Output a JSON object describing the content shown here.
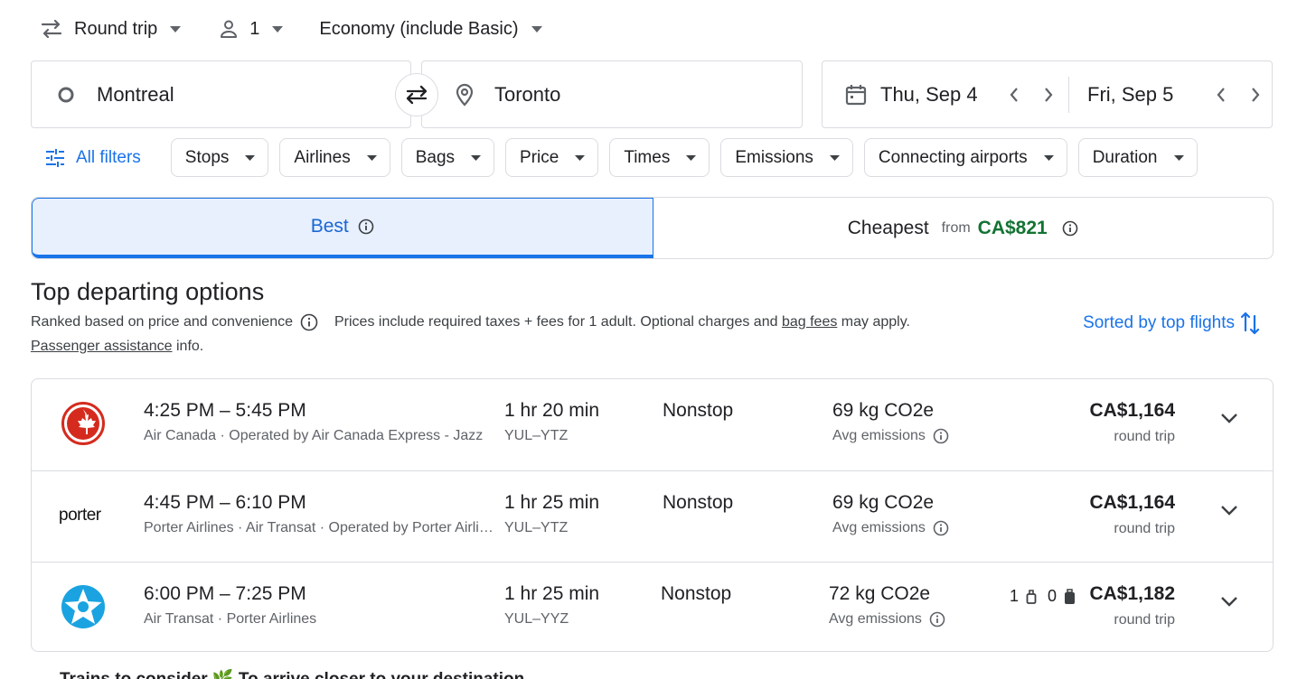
{
  "search": {
    "trip_type": "Round trip",
    "passengers": "1",
    "cabin_class": "Economy (include Basic)",
    "origin": "Montreal",
    "destination": "Toronto",
    "depart_date": "Thu, Sep 4",
    "return_date": "Fri, Sep 5"
  },
  "filters": {
    "all_filters": "All filters",
    "chips": [
      "Stops",
      "Airlines",
      "Bags",
      "Price",
      "Times",
      "Emissions",
      "Connecting airports",
      "Duration"
    ]
  },
  "tabs": {
    "best": "Best",
    "cheapest": "Cheapest",
    "cheapest_from": "from",
    "cheapest_price": "CA$821"
  },
  "results": {
    "heading": "Top departing options",
    "ranked_note": "Ranked based on price and convenience",
    "prices_note_prefix": "Prices include required taxes + fees for 1 adult. Optional charges and",
    "bag_fees_link": "bag fees",
    "prices_note_suffix": "may apply.",
    "passenger_assistance_link": "Passenger assistance",
    "passenger_assistance_suffix": "info.",
    "sort_label": "Sorted by top flights"
  },
  "flights": [
    {
      "logo": "air-canada-logo",
      "times": "4:25 PM – 5:45 PM",
      "airline": "Air Canada · Operated by Air Canada Express - Jazz",
      "duration": "1 hr 20 min",
      "route": "YUL–YTZ",
      "stops": "Nonstop",
      "emissions": "69 kg CO2e",
      "emissions_label": "Avg emissions",
      "price": "CA$1,164",
      "trip": "round trip"
    },
    {
      "logo": "porter",
      "times": "4:45 PM – 6:10 PM",
      "airline": "Porter Airlines · Air Transat · Operated by Porter Airlines",
      "duration": "1 hr 25 min",
      "route": "YUL–YTZ",
      "stops": "Nonstop",
      "emissions": "69 kg CO2e",
      "emissions_label": "Avg emissions",
      "price": "CA$1,164",
      "trip": "round trip"
    },
    {
      "logo": "air-transat-logo",
      "times": "6:00 PM – 7:25 PM",
      "airline": "Air Transat · Porter Airlines",
      "duration": "1 hr 25 min",
      "route": "YUL–YYZ",
      "stops": "Nonstop",
      "emissions": "72 kg CO2e",
      "emissions_label": "Avg emissions",
      "carry_on_count": "1",
      "checked_bag_count": "0",
      "price": "CA$1,182",
      "trip": "round trip"
    }
  ],
  "trains_teaser": "Trains to consider 🌿 To arrive closer to your destination",
  "colors": {
    "accent": "#1a73e8",
    "price_green": "#137333",
    "air_canada_red": "#d52b1e",
    "air_transat_blue": "#1aa3e0"
  }
}
